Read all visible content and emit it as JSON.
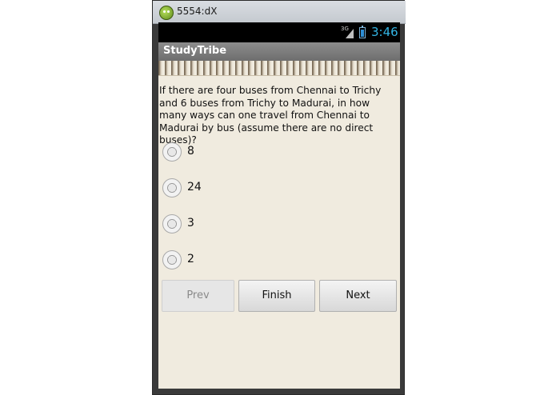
{
  "window": {
    "title": "5554:dX"
  },
  "status_bar": {
    "network": "3G",
    "time": "3:46"
  },
  "app": {
    "title": "StudyTribe"
  },
  "quiz": {
    "question": "If there are four buses from Chennai to Trichy and 6 buses from Trichy to Madurai, in how many ways can one travel from Chennai to Madurai by bus (assume there are no direct buses)?",
    "options": [
      "8",
      "24",
      "3",
      "2"
    ]
  },
  "buttons": {
    "prev": "Prev",
    "finish": "Finish",
    "next": "Next"
  },
  "colors": {
    "clock": "#33b5e5",
    "paper": "#f0ebdf",
    "appbar": "#7d7d7d"
  }
}
